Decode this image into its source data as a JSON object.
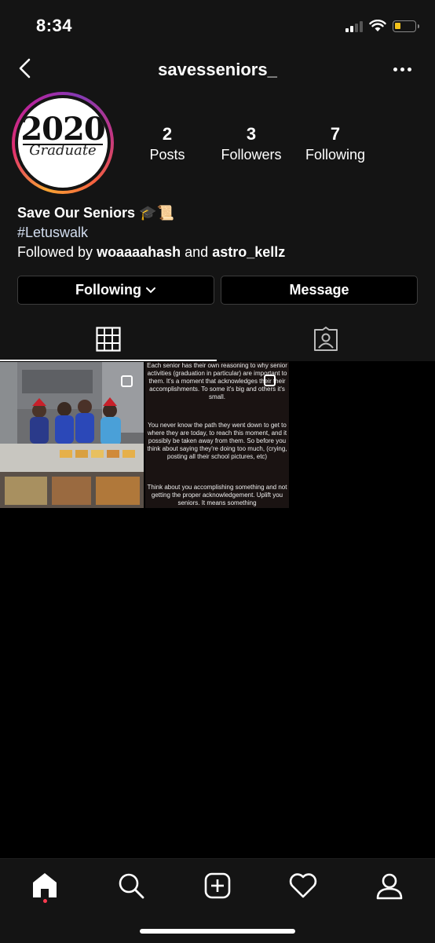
{
  "status_bar": {
    "time": "8:34",
    "battery_color": "#f3c21b",
    "battery_level": 0.22
  },
  "header": {
    "username": "savesseniors_"
  },
  "avatar": {
    "year": "2020",
    "subtitle": "Graduate"
  },
  "stats": {
    "posts": {
      "count": "2",
      "label": "Posts"
    },
    "followers": {
      "count": "3",
      "label": "Followers"
    },
    "following": {
      "count": "7",
      "label": "Following"
    }
  },
  "bio": {
    "name": "Save Our Seniors",
    "emoji": "🎓📜",
    "hashtag": "#Letuswalk",
    "followed_prefix": "Followed by",
    "followed_user1": "woaaaahash",
    "followed_and": "and",
    "followed_user2": "astro_kellz"
  },
  "actions": {
    "following_label": "Following",
    "message_label": "Message"
  },
  "tabs": {
    "grid_icon": "grid-icon",
    "tagged_icon": "tagged-icon"
  },
  "posts": {
    "post2_p1": "Each senior has their own reasoning to why senior activities (graduation in particular) are important to them. It's a moment that acknowledges their their accomplishments. To some it's big and others it's small.",
    "post2_p2": "You never know the path they went down to get to where they are today, to reach this moment, and it possibly be taken away from them. So before you think about saying they're doing too much, (crying, posting all their school pictures, etc)",
    "post2_p3": "Think about you accomplishing something and not getting the proper acknowledgement. Uplift you seniors. It means something"
  },
  "bottom_nav": {
    "items": [
      "home-icon",
      "search-icon",
      "add-post-icon",
      "heart-icon",
      "profile-icon"
    ],
    "active": "home-icon",
    "notification_color": "#ff3b4f"
  },
  "colors": {
    "background": "#000000",
    "surface": "#141414",
    "hashtag": "#d3def0"
  }
}
